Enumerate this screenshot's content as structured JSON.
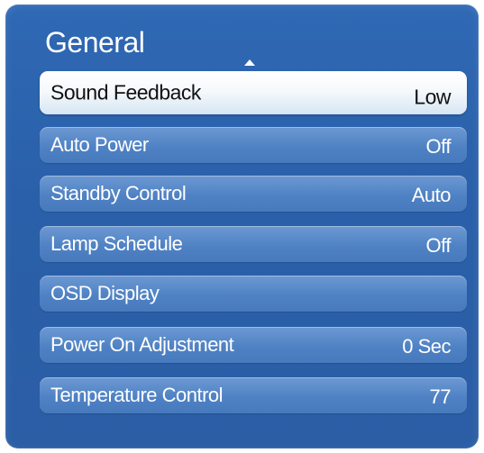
{
  "menu": {
    "title": "General",
    "items": [
      {
        "label": "Sound Feedback",
        "value": "Low"
      },
      {
        "label": "Auto Power",
        "value": "Off"
      },
      {
        "label": "Standby Control",
        "value": "Auto"
      },
      {
        "label": "Lamp Schedule",
        "value": "Off"
      },
      {
        "label": "OSD Display",
        "value": ""
      },
      {
        "label": "Power On Adjustment",
        "value": "0 Sec"
      },
      {
        "label": "Temperature Control",
        "value": "77"
      }
    ],
    "selected_index": 0
  },
  "icons": {
    "scroll_up": "up-arrow-icon"
  },
  "colors": {
    "panel": "#2b62ab",
    "item": "#5b8ac9",
    "selected_item": "#f2f6fb"
  }
}
